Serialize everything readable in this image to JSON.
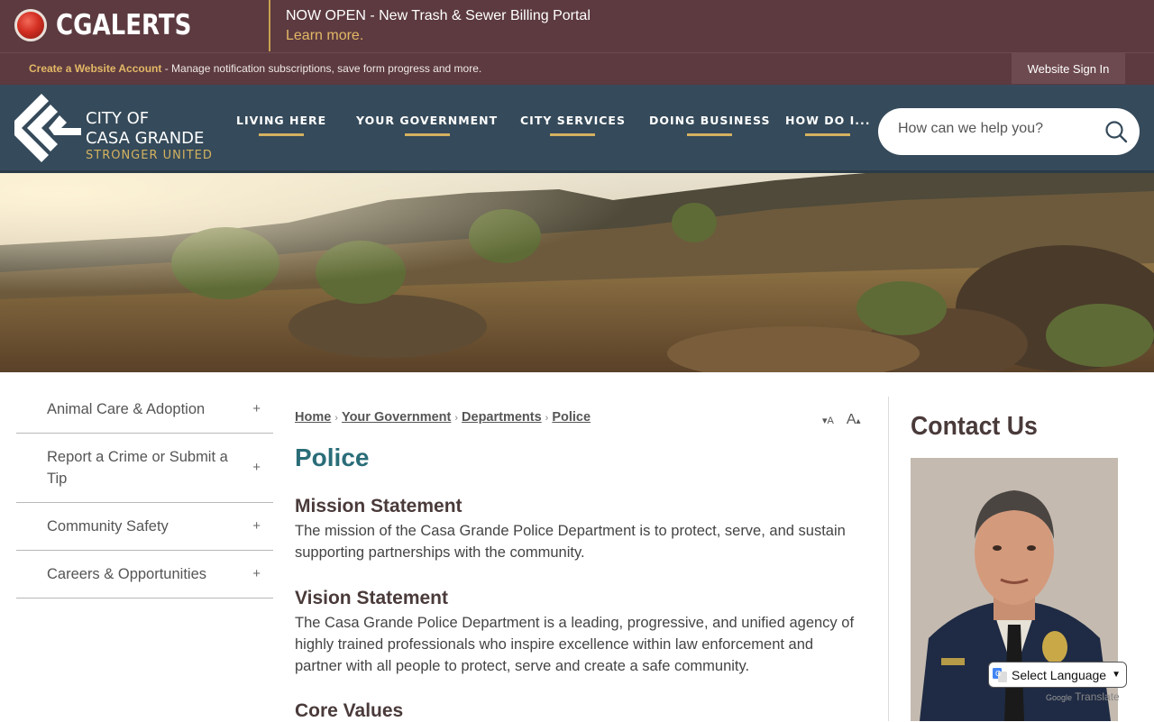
{
  "alert": {
    "brand": "CGALERTS",
    "headline": "NOW OPEN - New Trash & Sewer Billing Portal",
    "link": "Learn more."
  },
  "account": {
    "create_link": "Create a Website Account",
    "description": " - Manage notification subscriptions, save form progress and more.",
    "signin": "Website Sign In"
  },
  "logo": {
    "line1": "CITY OF",
    "line2": "CASA GRANDE",
    "tagline": "STRONGER UNITED"
  },
  "nav": {
    "items": [
      "LIVING HERE",
      "YOUR GOVERNMENT",
      "CITY SERVICES",
      "DOING BUSINESS",
      "HOW DO I..."
    ]
  },
  "search": {
    "placeholder": "How can we help you?"
  },
  "sidebar": {
    "items": [
      {
        "label": "Animal Care & Adoption",
        "toggle": "+"
      },
      {
        "label": "Report a Crime or Submit a Tip",
        "toggle": "+"
      },
      {
        "label": "Community Safety",
        "toggle": "+"
      },
      {
        "label": "Careers & Opportunities",
        "toggle": "+"
      }
    ]
  },
  "breadcrumb": {
    "items": [
      "Home",
      "Your Government",
      "Departments",
      "Police"
    ],
    "separator": "›"
  },
  "font_tools": {
    "decrease": "A",
    "increase": "A"
  },
  "main": {
    "title": "Police",
    "sections": [
      {
        "heading": "Mission Statement",
        "body": "The mission of the Casa Grande Police Department is to protect, serve, and sustain supporting partnerships with the community."
      },
      {
        "heading": "Vision Statement",
        "body": "The Casa Grande Police Department is a leading, progressive, and unified agency of highly trained professionals who inspire excellence within law enforcement and partner with all people to protect, serve and create a safe community."
      },
      {
        "heading": "Core Values",
        "body": ""
      }
    ]
  },
  "contact": {
    "title": "Contact Us"
  },
  "translate": {
    "label": "Select Language",
    "powered": "Translate",
    "google": "Google"
  },
  "colors": {
    "alert_bg": "#5c3a40",
    "nav_bg": "#354a5a",
    "accent_gold": "#d4b260",
    "title_teal": "#2a6d78"
  }
}
